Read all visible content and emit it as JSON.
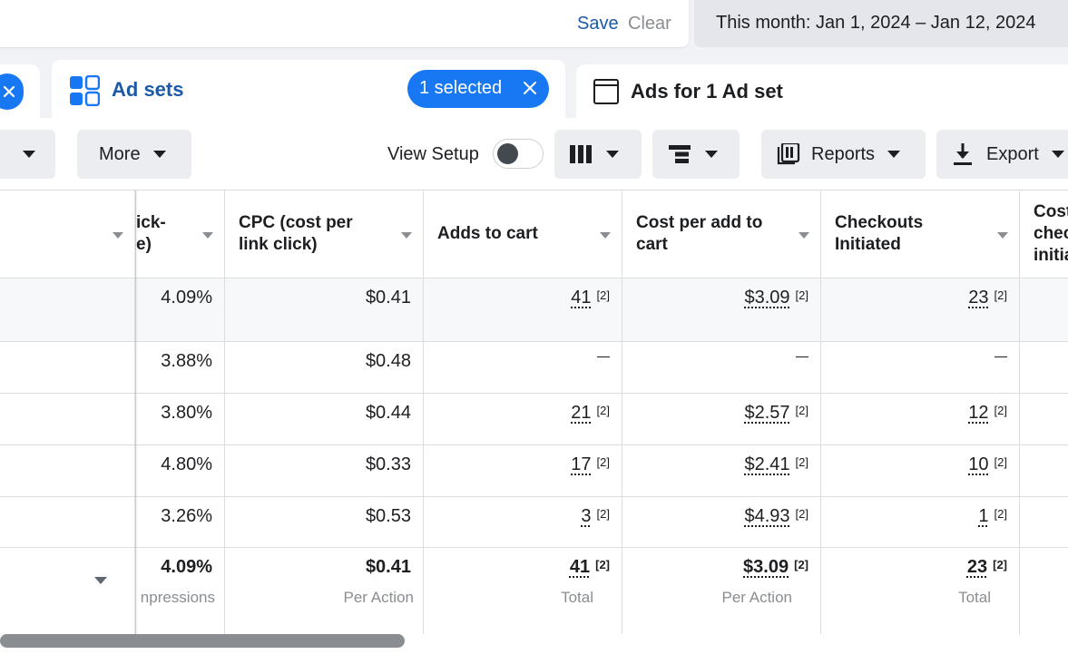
{
  "top": {
    "save_label": "Save",
    "clear_label": "Clear",
    "date_range": "This month: Jan 1, 2024 – Jan 12, 2024"
  },
  "tabs": {
    "adsets_label": "Ad sets",
    "selected_label": "1 selected",
    "ads_label": "Ads for 1 Ad set"
  },
  "toolbar": {
    "more_label": "More",
    "view_setup_label": "View Setup",
    "view_setup_on": false,
    "reports_label": "Reports",
    "export_label": "Export"
  },
  "table": {
    "headers": {
      "ctr": "ick-\ne)",
      "cpc": "CPC (cost per\nlink click)",
      "adds": "Adds to cart",
      "cost_add": "Cost per add to\ncart",
      "checkouts": "Checkouts\nInitiated",
      "cost_checkout": "Cost\nchec\ninitia"
    },
    "footnote": "[2]",
    "rows": [
      {
        "ctr": "4.09%",
        "cpc": "$0.41",
        "adds": "41",
        "cost_add": "$3.09",
        "checkouts": "23"
      },
      {
        "ctr": "3.88%",
        "cpc": "$0.48",
        "adds": null,
        "cost_add": null,
        "checkouts": null
      },
      {
        "ctr": "3.80%",
        "cpc": "$0.44",
        "adds": "21",
        "cost_add": "$2.57",
        "checkouts": "12"
      },
      {
        "ctr": "4.80%",
        "cpc": "$0.33",
        "adds": "17",
        "cost_add": "$2.41",
        "checkouts": "10"
      },
      {
        "ctr": "3.26%",
        "cpc": "$0.53",
        "adds": "3",
        "cost_add": "$4.93",
        "checkouts": "1"
      }
    ],
    "totals": {
      "ctr": "4.09%",
      "ctr_sub": "npressions",
      "cpc": "$0.41",
      "cpc_sub": "Per Action",
      "adds": "41",
      "adds_sub": "Total",
      "cost_add": "$3.09",
      "cost_add_sub": "Per Action",
      "checkouts": "23",
      "checkouts_sub": "Total"
    }
  },
  "colors": {
    "accent": "#1877f2",
    "link": "#1b5aa8",
    "button_bg": "#ebedf0",
    "muted": "#8a8d91"
  }
}
